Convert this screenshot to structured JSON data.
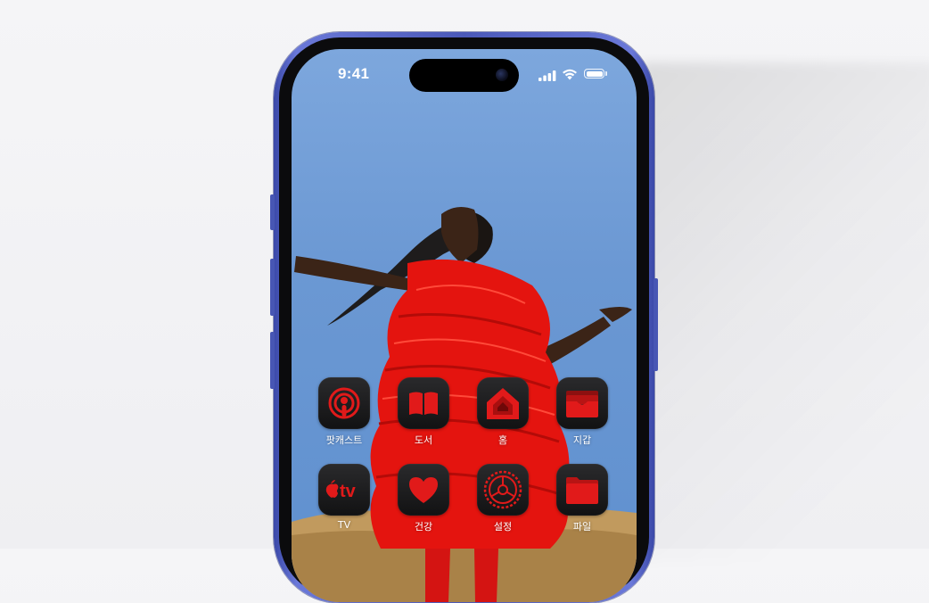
{
  "status_bar": {
    "time": "9:41"
  },
  "accent_color": "#e11a1a",
  "apps": [
    {
      "label": "팟캐스트",
      "icon": "podcasts-icon"
    },
    {
      "label": "도서",
      "icon": "books-icon"
    },
    {
      "label": "홈",
      "icon": "home-icon"
    },
    {
      "label": "지갑",
      "icon": "wallet-icon"
    },
    {
      "label": "TV",
      "icon": "appletv-icon"
    },
    {
      "label": "건강",
      "icon": "health-icon"
    },
    {
      "label": "설정",
      "icon": "settings-icon"
    },
    {
      "label": "파일",
      "icon": "files-icon"
    }
  ]
}
